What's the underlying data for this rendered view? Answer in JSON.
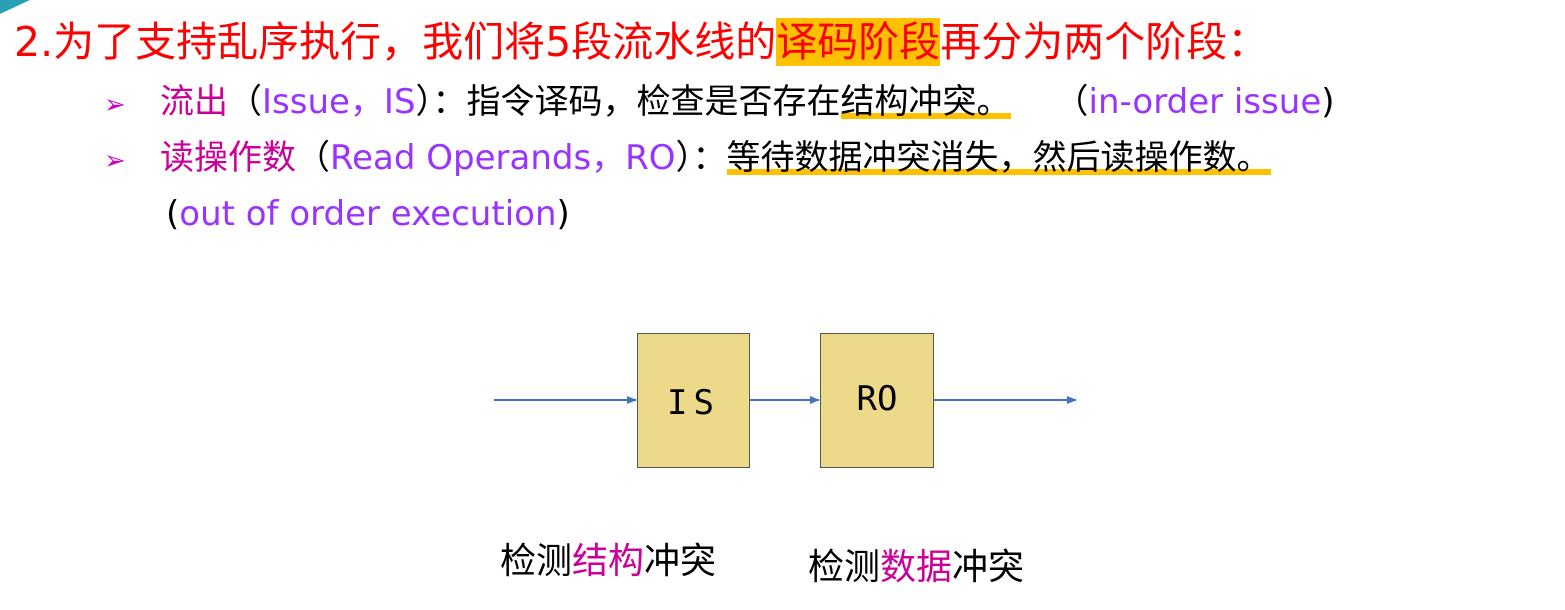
{
  "title": {
    "before": "2.为了支持乱序执行，我们将5段流水线的",
    "highlight": "译码阶段",
    "after": "再分为两个阶段："
  },
  "bullets": [
    {
      "marker": "➢",
      "term": "流出",
      "open": "（",
      "term_en": "Issue，IS",
      "close": "）",
      "desc_plain": "：指令译码，检查是否存在",
      "desc_underlined": "结构冲突。",
      "note_open": "（",
      "note": "in-order issue",
      "note_close": ")"
    },
    {
      "marker": "➢",
      "term": "读操作数",
      "open": "（",
      "term_en": "Read Operands，RO",
      "close": "）",
      "desc_plain": "：",
      "desc_underlined": "等待数据冲突消失，然后读操作数。",
      "note_open": "(",
      "note": "out of order execution",
      "note_close": ")"
    }
  ],
  "diagram": {
    "box_is": "IS",
    "box_ro": "RO",
    "arrow_color": "#4472c4",
    "box_fill": "#ecd98a"
  },
  "captions": [
    {
      "pre": "检测",
      "key": "结构",
      "post": "冲突"
    },
    {
      "pre": "检测",
      "key": "数据",
      "post": "冲突"
    }
  ],
  "colors": {
    "title": "#ff0000",
    "highlight": "#ffc000",
    "term": "#cc0099",
    "english": "#9933ff"
  },
  "icons": {
    "corner": "corner-decoration-icon",
    "bullet": "arrow-bullet-icon"
  }
}
